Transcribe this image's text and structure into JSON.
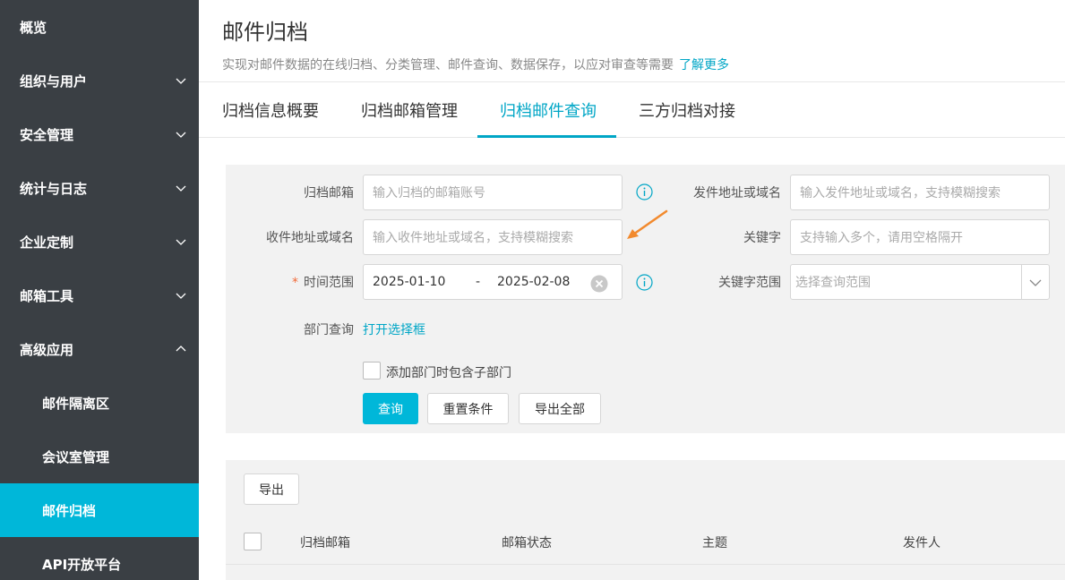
{
  "sidebar": {
    "items": [
      {
        "label": "概览"
      },
      {
        "label": "组织与用户"
      },
      {
        "label": "安全管理"
      },
      {
        "label": "统计与日志"
      },
      {
        "label": "企业定制"
      },
      {
        "label": "邮箱工具"
      },
      {
        "label": "高级应用"
      },
      {
        "label": "邮件隔离区"
      },
      {
        "label": "会议室管理"
      },
      {
        "label": "邮件归档"
      },
      {
        "label": "API开放平台"
      }
    ]
  },
  "header": {
    "title": "邮件归档",
    "description": "实现对邮件数据的在线归档、分类管理、邮件查询、数据保存，以应对审查等需要",
    "learn_more": "了解更多"
  },
  "tabs": [
    {
      "label": "归档信息概要"
    },
    {
      "label": "归档邮箱管理"
    },
    {
      "label": "归档邮件查询"
    },
    {
      "label": "三方归档对接"
    }
  ],
  "form": {
    "archive_mailbox": {
      "label": "归档邮箱",
      "placeholder": "输入归档的邮箱账号"
    },
    "sender": {
      "label": "发件地址或域名",
      "placeholder": "输入发件地址或域名，支持模糊搜索"
    },
    "recipient": {
      "label": "收件地址或域名",
      "placeholder": "输入收件地址或域名，支持模糊搜索"
    },
    "keyword": {
      "label": "关键字",
      "placeholder": "支持输入多个，请用空格隔开"
    },
    "time_range": {
      "required_mark": "*",
      "label": "时间范围",
      "start": "2025-01-10",
      "separator": "-",
      "end": "2025-02-08"
    },
    "keyword_scope": {
      "label": "关键字范围",
      "placeholder": "选择查询范围"
    },
    "department": {
      "label": "部门查询",
      "link": "打开选择框"
    },
    "include_sub": {
      "label": "添加部门时包含子部门"
    },
    "buttons": {
      "query": "查询",
      "reset": "重置条件",
      "export_all": "导出全部"
    }
  },
  "table": {
    "export_label": "导出",
    "columns": [
      "归档邮箱",
      "邮箱状态",
      "主题",
      "发件人"
    ]
  },
  "colors": {
    "sidebar_bg": "#3a3f44",
    "accent": "#00b7d9",
    "link": "#00a6c6",
    "annotation_arrow": "#f28a2e"
  }
}
